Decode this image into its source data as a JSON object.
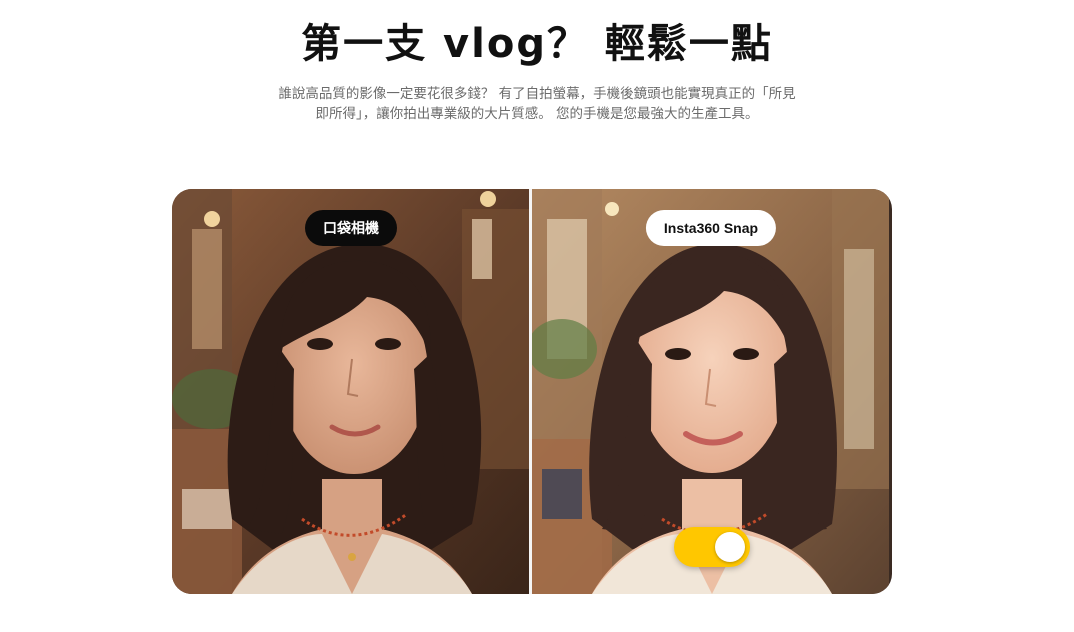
{
  "section": {
    "heading": "第一支 vlog？ 輕鬆一點",
    "subtitle": "誰說高品質的影像一定要花很多錢？ 有了自拍螢幕，手機後鏡頭也能實現真正的「所見即所得」，讓你拍出專業級的大片質感。 您的手機是您最強大的生產工具。"
  },
  "comparison": {
    "left_label": "口袋相機",
    "right_label": "Insta360 Snap",
    "toggle_on": true,
    "toggle_color": "#ffc700"
  }
}
